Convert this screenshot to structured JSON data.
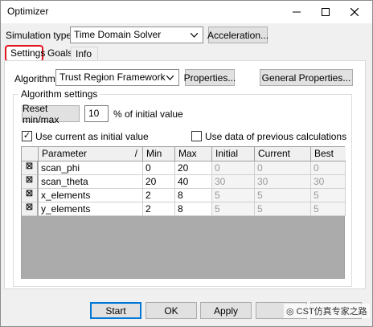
{
  "window": {
    "title": "Optimizer",
    "min_icon": "minimize-icon",
    "max_icon": "maximize-icon",
    "close_icon": "close-icon"
  },
  "simulation": {
    "label": "Simulation type:",
    "value": "Time Domain Solver",
    "acceleration_label": "Acceleration..."
  },
  "tabs": [
    {
      "label": "Settings",
      "active": true
    },
    {
      "label": "Goals",
      "active": false
    },
    {
      "label": "Info",
      "active": false
    }
  ],
  "algorithm": {
    "label": "Algorithm:",
    "value": "Trust Region Framework",
    "properties_label": "Properties...",
    "general_properties_label": "General Properties..."
  },
  "settings": {
    "group_title": "Algorithm settings",
    "reset_label": "Reset min/max",
    "reset_value": "10",
    "reset_suffix": "% of initial value",
    "use_current_label": "Use current as initial value",
    "use_current_checked": true,
    "use_data_label": "Use data of previous calculations",
    "use_data_checked": false
  },
  "grid": {
    "headers": [
      "Parameter",
      "/",
      "Min",
      "Max",
      "Initial",
      "Current",
      "Best"
    ],
    "rows": [
      {
        "param": "scan_phi",
        "min": "0",
        "max": "20",
        "initial": "0",
        "current": "0",
        "best": "0",
        "checked": true
      },
      {
        "param": "scan_theta",
        "min": "20",
        "max": "40",
        "initial": "30",
        "current": "30",
        "best": "30",
        "checked": true
      },
      {
        "param": "x_elements",
        "min": "2",
        "max": "8",
        "initial": "5",
        "current": "5",
        "best": "5",
        "checked": true
      },
      {
        "param": "y_elements",
        "min": "2",
        "max": "8",
        "initial": "5",
        "current": "5",
        "best": "5",
        "checked": true
      }
    ]
  },
  "footer": {
    "start_label": "Start",
    "ok_label": "OK",
    "apply_label": "Apply"
  },
  "watermark": "CST仿真专家之路",
  "colors": {
    "tab_highlight": "#e0141e",
    "default_button_border": "#0078d7",
    "window_bg": "#f0f0f0"
  }
}
